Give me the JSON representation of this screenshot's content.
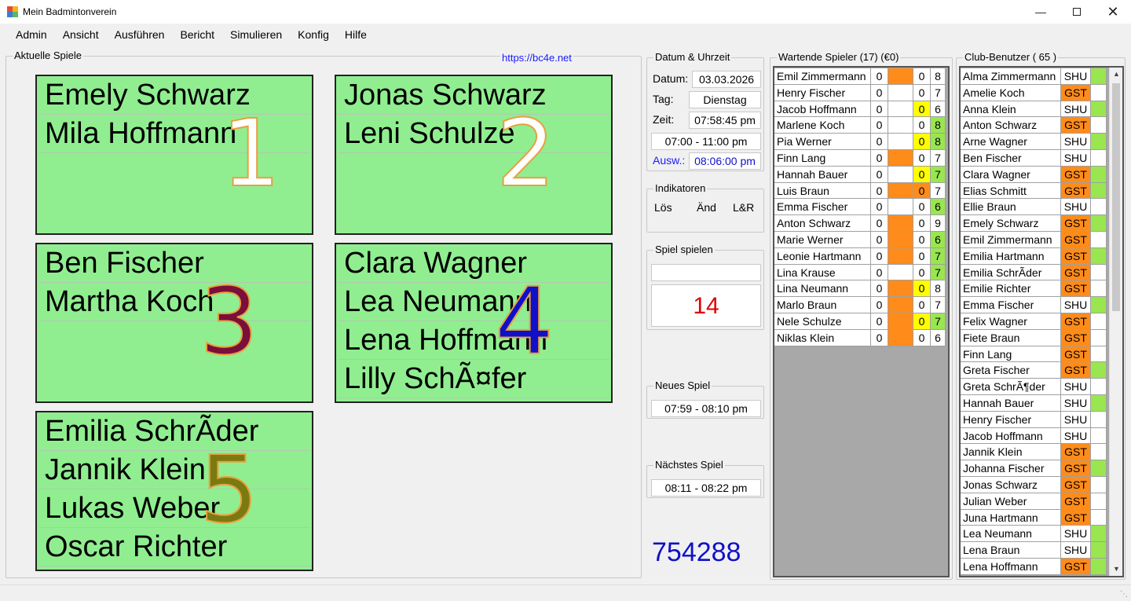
{
  "window": {
    "title": "Mein Badmintonverein"
  },
  "menu": [
    "Admin",
    "Ansicht",
    "Ausführen",
    "Bericht",
    "Simulieren",
    "Konfig",
    "Hilfe"
  ],
  "games": {
    "label": "Aktuelle Spiele",
    "link": "https://bc4e.net",
    "courts": [
      {
        "number": "1",
        "color": "#ffffff",
        "players": [
          "Emely Schwarz",
          "Mila Hoffmann"
        ]
      },
      {
        "number": "2",
        "color": "#ffffff",
        "players": [
          "Jonas Schwarz",
          "Leni Schulze"
        ]
      },
      {
        "number": "3",
        "color": "#7a0f3a",
        "players": [
          "Ben Fischer",
          "Martha Koch"
        ]
      },
      {
        "number": "4",
        "color": "#1010c8",
        "players": [
          "Clara Wagner",
          "Lea Neumann",
          "Lena Hoffmann",
          "Lilly SchÃ¤fer"
        ]
      },
      {
        "number": "5",
        "color": "#7b7a10",
        "players": [
          "Emilia SchrÃder",
          "Jannik Klein",
          "Lukas Weber",
          "Oscar Richter"
        ]
      }
    ]
  },
  "datetime": {
    "label": "Datum & Uhrzeit",
    "date_label": "Datum:",
    "date": "03.03.2026",
    "day_label": "Tag:",
    "day": "Dienstag",
    "time_label": "Zeit:",
    "time": "07:58:45 pm",
    "range": "07:00 - 11:00 pm",
    "ausw_label": "Ausw.:",
    "ausw": "08:06:00 pm"
  },
  "indicators": {
    "label": "Indikatoren",
    "items": [
      "Lös",
      "Änd",
      "L&R"
    ]
  },
  "play": {
    "label": "Spiel spielen",
    "value": "",
    "count": "14"
  },
  "new_game": {
    "label": "Neues Spiel",
    "value": "07:59 - 08:10 pm"
  },
  "next_game": {
    "label": "Nächstes Spiel",
    "value": "08:11 - 08:22 pm"
  },
  "code": "754288",
  "colors": {
    "orange": "#ff8c1a",
    "yellow": "#ffff00",
    "green": "#99e650",
    "accent_blue": "#1010c8",
    "red": "#e00000"
  },
  "waiting": {
    "label": "Wartende Spieler (17) (€0)",
    "rows": [
      {
        "name": "Emil Zimmermann",
        "n": "0",
        "bar": "orange",
        "m": "0",
        "mc": "white",
        "s": "8",
        "sc": "white"
      },
      {
        "name": "Henry Fischer",
        "n": "0",
        "bar": "white",
        "m": "0",
        "mc": "white",
        "s": "7",
        "sc": "white"
      },
      {
        "name": "Jacob Hoffmann",
        "n": "0",
        "bar": "white",
        "m": "0",
        "mc": "yellow",
        "s": "6",
        "sc": "white"
      },
      {
        "name": "Marlene Koch",
        "n": "0",
        "bar": "white",
        "m": "0",
        "mc": "white",
        "s": "8",
        "sc": "green"
      },
      {
        "name": "Pia Werner",
        "n": "0",
        "bar": "white",
        "m": "0",
        "mc": "yellow",
        "s": "8",
        "sc": "green"
      },
      {
        "name": "Finn Lang",
        "n": "0",
        "bar": "orange",
        "m": "0",
        "mc": "white",
        "s": "7",
        "sc": "white"
      },
      {
        "name": "Hannah Bauer",
        "n": "0",
        "bar": "white",
        "m": "0",
        "mc": "yellow",
        "s": "7",
        "sc": "green"
      },
      {
        "name": "Luis Braun",
        "n": "0",
        "bar": "orange",
        "m": "0",
        "mc": "orange",
        "s": "7",
        "sc": "white"
      },
      {
        "name": "Emma Fischer",
        "n": "0",
        "bar": "white",
        "m": "0",
        "mc": "white",
        "s": "6",
        "sc": "green"
      },
      {
        "name": "Anton Schwarz",
        "n": "0",
        "bar": "orange",
        "m": "0",
        "mc": "white",
        "s": "9",
        "sc": "white"
      },
      {
        "name": "Marie Werner",
        "n": "0",
        "bar": "orange",
        "m": "0",
        "mc": "white",
        "s": "6",
        "sc": "green"
      },
      {
        "name": "Leonie Hartmann",
        "n": "0",
        "bar": "orange",
        "m": "0",
        "mc": "white",
        "s": "7",
        "sc": "green"
      },
      {
        "name": "Lina Krause",
        "n": "0",
        "bar": "white",
        "m": "0",
        "mc": "white",
        "s": "7",
        "sc": "green"
      },
      {
        "name": "Lina Neumann",
        "n": "0",
        "bar": "orange",
        "m": "0",
        "mc": "yellow",
        "s": "8",
        "sc": "white"
      },
      {
        "name": "Marlo Braun",
        "n": "0",
        "bar": "orange",
        "m": "0",
        "mc": "white",
        "s": "7",
        "sc": "white"
      },
      {
        "name": "Nele Schulze",
        "n": "0",
        "bar": "orange",
        "m": "0",
        "mc": "yellow",
        "s": "7",
        "sc": "green"
      },
      {
        "name": "Niklas Klein",
        "n": "0",
        "bar": "orange",
        "m": "0",
        "mc": "white",
        "s": "6",
        "sc": "white"
      }
    ]
  },
  "club": {
    "label": "Club-Benutzer ( 65 )",
    "rows": [
      {
        "name": "Alma Zimmermann",
        "type": "SHU",
        "tc": "white",
        "flag": "green"
      },
      {
        "name": "Amelie Koch",
        "type": "GST",
        "tc": "orange",
        "flag": "white"
      },
      {
        "name": "Anna Klein",
        "type": "SHU",
        "tc": "white",
        "flag": "green"
      },
      {
        "name": "Anton Schwarz",
        "type": "GST",
        "tc": "orange",
        "flag": "white"
      },
      {
        "name": "Arne Wagner",
        "type": "SHU",
        "tc": "white",
        "flag": "green"
      },
      {
        "name": "Ben Fischer",
        "type": "SHU",
        "tc": "white",
        "flag": "white"
      },
      {
        "name": "Clara Wagner",
        "type": "GST",
        "tc": "orange",
        "flag": "green"
      },
      {
        "name": "Elias Schmitt",
        "type": "GST",
        "tc": "orange",
        "flag": "green"
      },
      {
        "name": "Ellie Braun",
        "type": "SHU",
        "tc": "white",
        "flag": "white"
      },
      {
        "name": "Emely Schwarz",
        "type": "GST",
        "tc": "orange",
        "flag": "green"
      },
      {
        "name": "Emil Zimmermann",
        "type": "GST",
        "tc": "orange",
        "flag": "white"
      },
      {
        "name": "Emilia Hartmann",
        "type": "GST",
        "tc": "orange",
        "flag": "green"
      },
      {
        "name": "Emilia SchrÃder",
        "type": "GST",
        "tc": "orange",
        "flag": "white"
      },
      {
        "name": "Emilie Richter",
        "type": "GST",
        "tc": "orange",
        "flag": "white"
      },
      {
        "name": "Emma Fischer",
        "type": "SHU",
        "tc": "white",
        "flag": "green"
      },
      {
        "name": "Felix Wagner",
        "type": "GST",
        "tc": "orange",
        "flag": "white"
      },
      {
        "name": "Fiete Braun",
        "type": "GST",
        "tc": "orange",
        "flag": "white"
      },
      {
        "name": "Finn Lang",
        "type": "GST",
        "tc": "orange",
        "flag": "white"
      },
      {
        "name": "Greta Fischer",
        "type": "GST",
        "tc": "orange",
        "flag": "green"
      },
      {
        "name": "Greta SchrÃ¶der",
        "type": "SHU",
        "tc": "white",
        "flag": "white"
      },
      {
        "name": "Hannah Bauer",
        "type": "SHU",
        "tc": "white",
        "flag": "green"
      },
      {
        "name": "Henry Fischer",
        "type": "SHU",
        "tc": "white",
        "flag": "white"
      },
      {
        "name": "Jacob Hoffmann",
        "type": "SHU",
        "tc": "white",
        "flag": "white"
      },
      {
        "name": "Jannik Klein",
        "type": "GST",
        "tc": "orange",
        "flag": "white"
      },
      {
        "name": "Johanna Fischer",
        "type": "GST",
        "tc": "orange",
        "flag": "green"
      },
      {
        "name": "Jonas Schwarz",
        "type": "GST",
        "tc": "orange",
        "flag": "white"
      },
      {
        "name": "Julian Weber",
        "type": "GST",
        "tc": "orange",
        "flag": "white"
      },
      {
        "name": "Juna Hartmann",
        "type": "GST",
        "tc": "orange",
        "flag": "white"
      },
      {
        "name": "Lea Neumann",
        "type": "SHU",
        "tc": "white",
        "flag": "green"
      },
      {
        "name": "Lena Braun",
        "type": "SHU",
        "tc": "white",
        "flag": "green"
      },
      {
        "name": "Lena Hoffmann",
        "type": "GST",
        "tc": "orange",
        "flag": "green"
      }
    ]
  }
}
